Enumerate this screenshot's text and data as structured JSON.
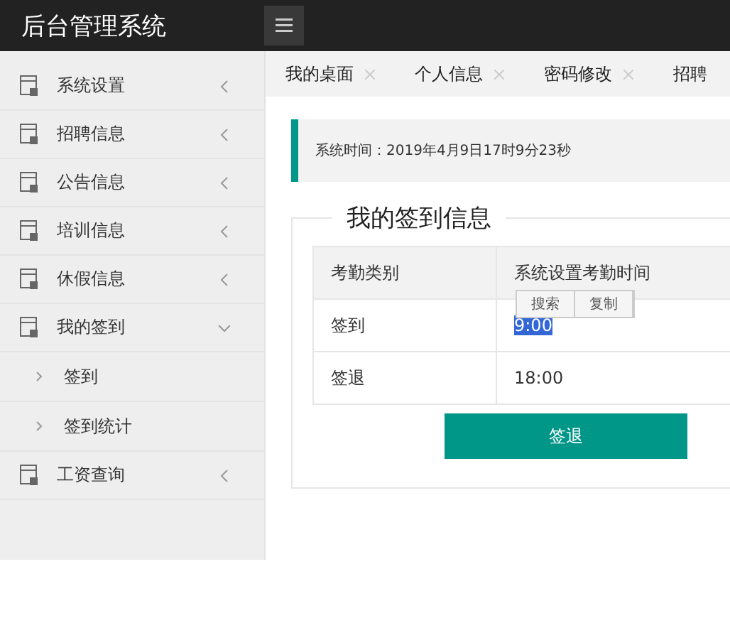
{
  "header": {
    "title": "后台管理系统"
  },
  "sidebar": {
    "items": [
      {
        "label": "系统设置",
        "expanded": false
      },
      {
        "label": "招聘信息",
        "expanded": false
      },
      {
        "label": "公告信息",
        "expanded": false
      },
      {
        "label": "培训信息",
        "expanded": false
      },
      {
        "label": "休假信息",
        "expanded": false
      },
      {
        "label": "我的签到",
        "expanded": true,
        "children": [
          {
            "label": "签到"
          },
          {
            "label": "签到统计"
          }
        ]
      },
      {
        "label": "工资查询",
        "expanded": false
      }
    ]
  },
  "tabs": [
    {
      "label": "我的桌面",
      "selected": false
    },
    {
      "label": "个人信息",
      "selected": false
    },
    {
      "label": "密码修改",
      "selected": false
    },
    {
      "label": "招聘",
      "selected": false
    }
  ],
  "notice": "系统时间：2019年4月9日17时9分23秒",
  "panel": {
    "legend": "我的签到信息",
    "table": {
      "columns": [
        "考勤类别",
        "系统设置考勤时间"
      ],
      "rows": [
        {
          "cells": [
            "签到",
            "9:00"
          ],
          "highlighted": true
        },
        {
          "cells": [
            "签退",
            "18:00"
          ],
          "highlighted": false
        }
      ]
    },
    "context_menu": [
      "搜索",
      "复制"
    ],
    "button": "签退"
  }
}
